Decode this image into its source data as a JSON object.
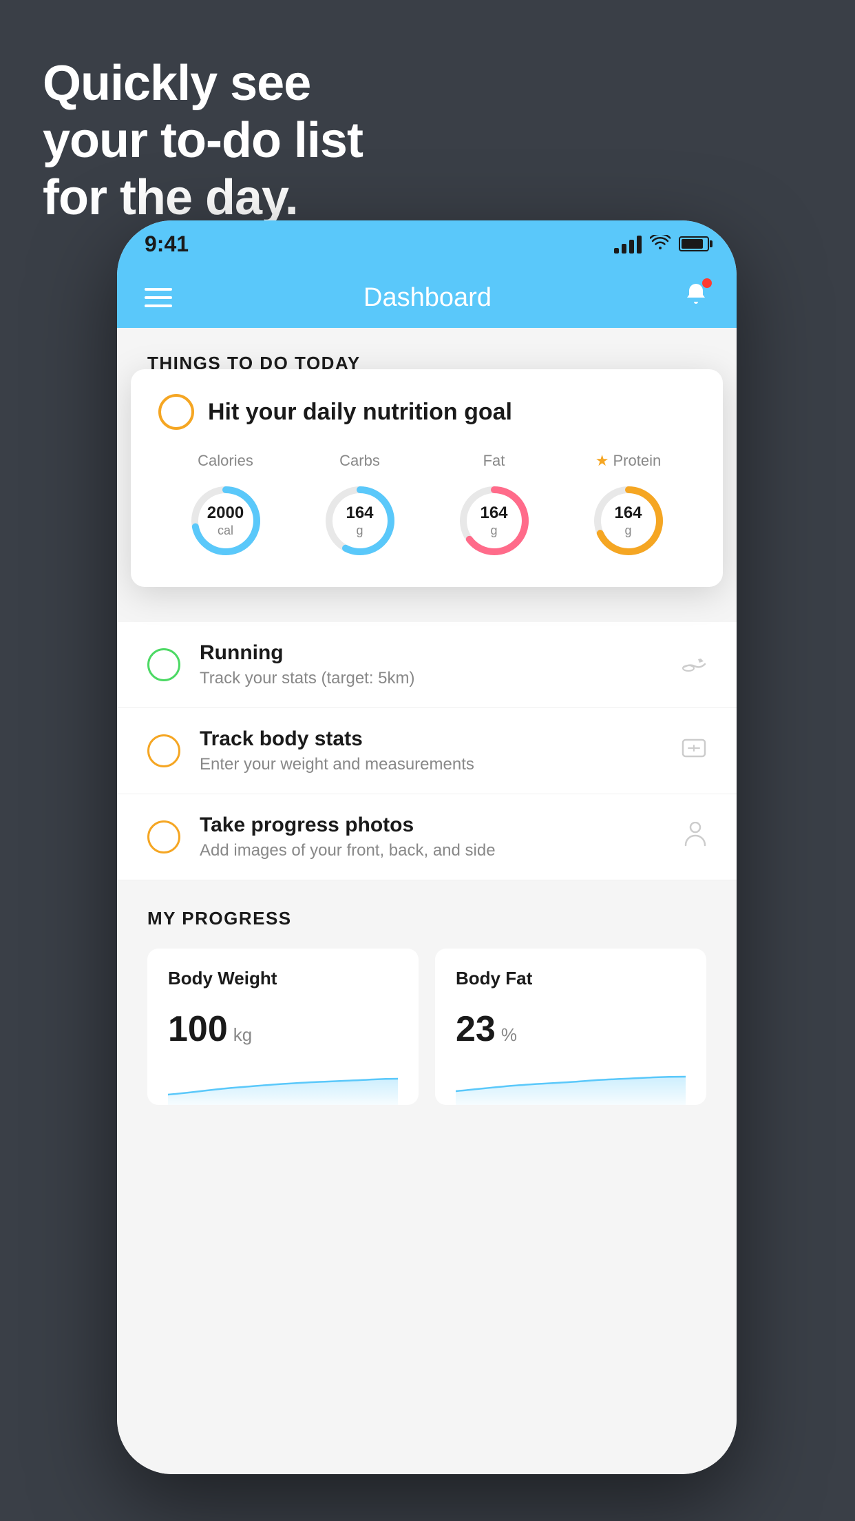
{
  "headline": {
    "line1": "Quickly see",
    "line2": "your to-do list",
    "line3": "for the day."
  },
  "status_bar": {
    "time": "9:41",
    "signal_alt": "signal bars",
    "wifi_alt": "wifi",
    "battery_alt": "battery"
  },
  "nav": {
    "title": "Dashboard",
    "menu_label": "menu",
    "bell_label": "notifications"
  },
  "things_today": {
    "section_title": "THINGS TO DO TODAY"
  },
  "nutrition_card": {
    "title": "Hit your daily nutrition goal",
    "calories_label": "Calories",
    "calories_value": "2000",
    "calories_unit": "cal",
    "carbs_label": "Carbs",
    "carbs_value": "164",
    "carbs_unit": "g",
    "fat_label": "Fat",
    "fat_value": "164",
    "fat_unit": "g",
    "protein_label": "Protein",
    "protein_value": "164",
    "protein_unit": "g"
  },
  "todo_items": [
    {
      "id": "running",
      "title": "Running",
      "subtitle": "Track your stats (target: 5km)",
      "circle_color": "green",
      "icon": "👟"
    },
    {
      "id": "body-stats",
      "title": "Track body stats",
      "subtitle": "Enter your weight and measurements",
      "circle_color": "yellow",
      "icon": "⚖️"
    },
    {
      "id": "photos",
      "title": "Take progress photos",
      "subtitle": "Add images of your front, back, and side",
      "circle_color": "yellow",
      "icon": "👤"
    }
  ],
  "progress": {
    "section_title": "MY PROGRESS",
    "cards": [
      {
        "id": "body-weight",
        "title": "Body Weight",
        "value": "100",
        "unit": "kg"
      },
      {
        "id": "body-fat",
        "title": "Body Fat",
        "value": "23",
        "unit": "%"
      }
    ]
  }
}
